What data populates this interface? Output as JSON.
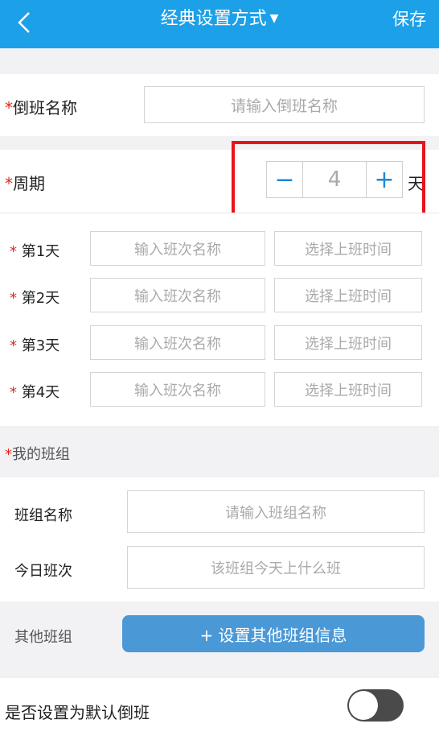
{
  "header": {
    "title": "经典设置方式",
    "dropdown_glyph": "▼",
    "save_label": "保存"
  },
  "shift_name": {
    "required_mark": "*",
    "label": "倒班名称",
    "placeholder": "请输入倒班名称"
  },
  "cycle": {
    "required_mark": "*",
    "label": "周期",
    "minus": "−",
    "value": "4",
    "plus": "+",
    "unit": "天"
  },
  "days": [
    {
      "required_mark": "*",
      "label": "第1天",
      "name_placeholder": "输入班次名称",
      "time_placeholder": "选择上班时间"
    },
    {
      "required_mark": "*",
      "label": "第2天",
      "name_placeholder": "输入班次名称",
      "time_placeholder": "选择上班时间"
    },
    {
      "required_mark": "*",
      "label": "第3天",
      "name_placeholder": "输入班次名称",
      "time_placeholder": "选择上班时间"
    },
    {
      "required_mark": "*",
      "label": "第4天",
      "name_placeholder": "输入班次名称",
      "time_placeholder": "选择上班时间"
    }
  ],
  "my_team": {
    "required_mark": "*",
    "label": "我的班组",
    "team_name_label": "班组名称",
    "team_name_placeholder": "请输入班组名称",
    "today_shift_label": "今日班次",
    "today_shift_placeholder": "该班组今天上什么班"
  },
  "other_team": {
    "label": "其他班组",
    "button_label": "+ 设置其他班组信息"
  },
  "default_shift": {
    "label": "是否设置为默认倒班",
    "toggle_on": false
  },
  "colors": {
    "header": "#1ca0e8",
    "required": "#e0281a",
    "highlight": "#e8141c",
    "accent_button": "#4a98d6"
  }
}
